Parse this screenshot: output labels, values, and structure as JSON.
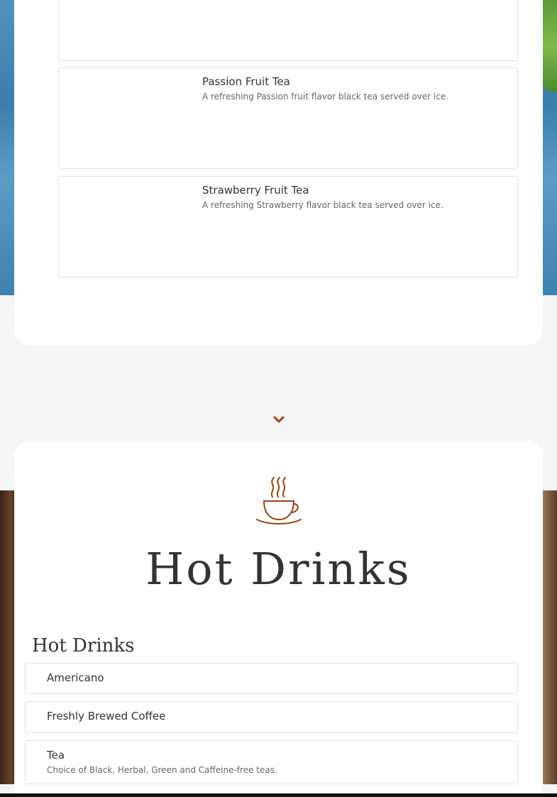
{
  "colors": {
    "accent": "#a0410d",
    "card_border": "#e2e2e2",
    "page_background": "#f5f5f5"
  },
  "cold_drinks": {
    "items": [
      {
        "name": "Passion Fruit Tea",
        "description": "A refreshing Passion fruit flavor black tea served over ice."
      },
      {
        "name": "Strawberry Fruit Tea",
        "description": "A refreshing Strawberry flavor black tea served over ice."
      }
    ]
  },
  "navigation": {
    "scroll_icon": "chevron-down-icon"
  },
  "hot_drinks": {
    "icon": "coffee-cup-icon",
    "heading": "Hot Drinks",
    "category_title": "Hot Drinks",
    "items": [
      {
        "name": "Americano",
        "description": ""
      },
      {
        "name": "Freshly Brewed Coffee",
        "description": ""
      },
      {
        "name": "Tea",
        "description": "Choice of Black, Herbal, Green and Caffeine-free teas."
      }
    ]
  }
}
